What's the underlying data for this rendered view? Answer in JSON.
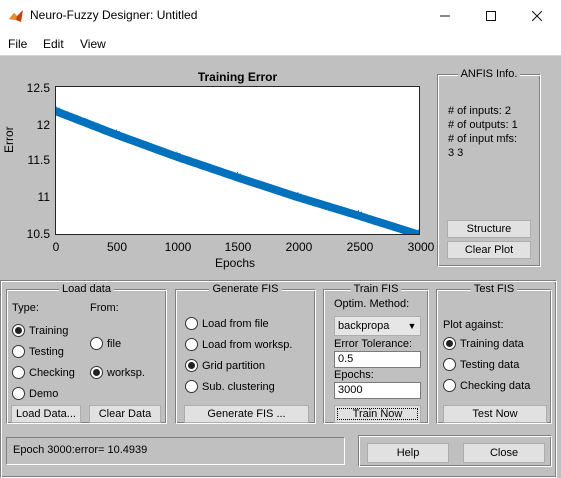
{
  "window": {
    "title": "Neuro-Fuzzy Designer: Untitled"
  },
  "menu": [
    "File",
    "Edit",
    "View"
  ],
  "chart_data": {
    "type": "line",
    "title": "Training Error",
    "xlabel": "Epochs",
    "ylabel": "Error",
    "xlim": [
      0,
      3000
    ],
    "ylim": [
      10.5,
      12.5
    ],
    "xticks": [
      "0",
      "500",
      "1000",
      "1500",
      "2000",
      "2500",
      "3000"
    ],
    "yticks": [
      "12.5",
      "12",
      "11.5",
      "11",
      "10.5"
    ],
    "series": [
      {
        "marker": "*",
        "color": "#0072bd",
        "x": [
          0,
          500,
          1000,
          1500,
          2000,
          2500,
          3000
        ],
        "y": [
          12.17,
          11.85,
          11.55,
          11.27,
          11.0,
          10.75,
          10.49
        ]
      }
    ]
  },
  "anfis_info": {
    "title": "ANFIS Info.",
    "lines": [
      "# of inputs: 2",
      "# of outputs: 1",
      "# of input mfs:",
      "3  3"
    ],
    "structure_label": "Structure",
    "clear_plot_label": "Clear Plot"
  },
  "load_data": {
    "title": "Load data",
    "type_label": "Type:",
    "from_label": "From:",
    "types": [
      "Training",
      "Testing",
      "Checking",
      "Demo"
    ],
    "from_options": [
      "file",
      "worksp."
    ],
    "load_button": "Load Data...",
    "clear_button": "Clear Data"
  },
  "generate_fis": {
    "title": "Generate FIS",
    "options": [
      "Load from file",
      "Load from worksp.",
      "Grid partition",
      "Sub. clustering"
    ],
    "button": "Generate FIS ..."
  },
  "train_fis": {
    "title": "Train FIS",
    "method_label": "Optim. Method:",
    "method_value": "backpropa",
    "tolerance_label": "Error Tolerance:",
    "tolerance_value": "0.5",
    "epochs_label": "Epochs:",
    "epochs_value": "3000",
    "button": "Train Now"
  },
  "test_fis": {
    "title": "Test FIS",
    "plot_against": "Plot against:",
    "options": [
      "Training data",
      "Testing data",
      "Checking data"
    ],
    "button": "Test Now"
  },
  "status": "Epoch 3000:error= 10.4939",
  "help_label": "Help",
  "close_label": "Close"
}
